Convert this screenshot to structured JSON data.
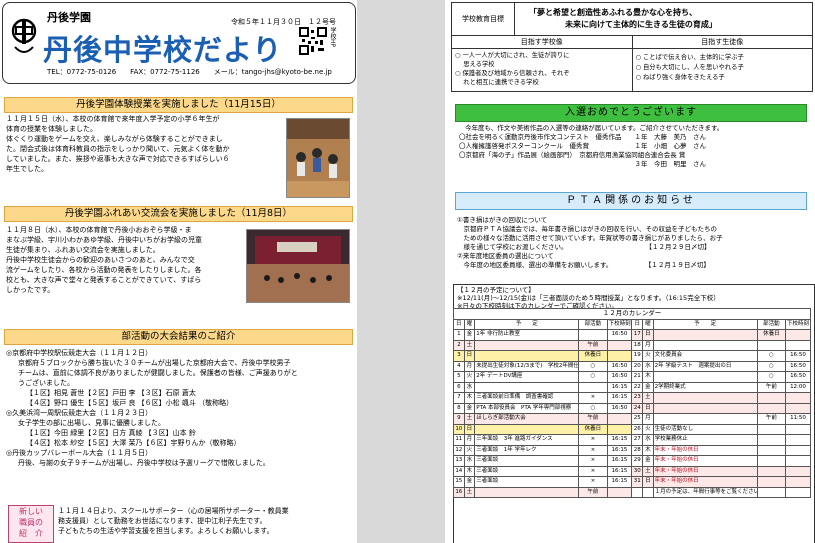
{
  "left": {
    "school_tag": "丹後学園",
    "issue": "令和５年１１月３０日　１２号号",
    "title": "丹後中学校だより",
    "qr_label": "学校HP",
    "contact": "TEL：0772-75-0126　　FAX：0772-75-1126　　メール：tango-jhs@kyoto-be.ne.jp",
    "s1": {
      "header": "丹後学園体験授業を実施しました（11月15日）",
      "lines": [
        "１１月１５日（水）、本校の体育館で来年度入学予定の小学６年生が",
        "体育の授業を体験しました。",
        "体ぐくり運動をゲームを交え、楽しみながら体験することができまし",
        "た。閉会式後は体育科教員の指示をしっかり聞いて、元気よく体を動か",
        "していました。また、挨拶や返事も大きな声で対応できるすばらしい６",
        "年生でした。"
      ]
    },
    "s2": {
      "header": "丹後学園ふれあい交流会を実施しました（11月8日）",
      "lines": [
        "１１月８日（水）、本校の体育館で丹後小おおぞら学級・ま",
        "まなぶ学級、宇川小わかあゆ学級、丹後中いちがお学級の児童",
        "生徒が集まり、ふれあい交流会を実施しました。",
        "丹後中学校生徒会からの歓迎のあいさつのあと、みんなで交",
        "流ゲームをしたり、各校から活動の発表をしたりしました。各",
        "校とも、大きな声で堂々と発表することができていて、すばら",
        "しかったです。"
      ]
    },
    "s3": {
      "header": "部活動の大会結果のご紹介",
      "lines": [
        "◎京都府中学校駅伝競走大会（１１月１２日）",
        "京都府５ブロックから勝ち抜いた３０チームが出場した京都府大会で、丹後中学校男子",
        "チームは、直前に体調不良がありましたが健闘しました。保護者の皆様、ご声援ありがと",
        "うございました。",
        "【１区】相見 蒼世【２区】戸田 李 【３区】石原 蒼太",
        "【４区】野口 優生【５区】坂戸 良 【６区】小松 颯斗 （敬称略）",
        "◎久美浜湾一周駅伝競走大会（１１月２３日）",
        "女子学生の部に出場し、見事に優勝しました。",
        "【１区】今田 緑里【２区】日方 真綾 【３区】山本 鈴",
        "【４区】松本 紗空【５区】大澤 茉乃【６区】宇野りんか（敬称略）",
        "◎丹後カップバレーボール大会（１１月５日）",
        "丹後、与謝の女子９チームが出場し、丹後中学校は予選リーグで惜敗しました。"
      ]
    },
    "new_staff": {
      "label": [
        "新しい",
        "職員の",
        "紹　介"
      ],
      "lines": [
        "１１月１４日より、スクールサポーター（心の居場所サポーター・教員業",
        "務支援員）として勤務をお世話になります、提中江利子先生です。",
        "子どもたちの生活や学習支援を担当します。よろしくお願いします。"
      ]
    }
  },
  "right": {
    "edu": {
      "label": "学校教育目標",
      "goal_1": "「夢と希望と創造性あふれる豊かな心を持ち、",
      "goal_2": "未来に向けて主体的に生きる生徒の育成」",
      "school_head": "目指す学校像",
      "student_head": "目指す生徒像",
      "school_items": [
        "○ 一人一人が大切にされ、生徒が誇りに",
        "　 思える学校",
        "○ 保護者及び地域から信頼され、それぞ",
        "　 れと相互に連携できる学校"
      ],
      "student_items": [
        "○ ことばで伝え合い、主体的に学ぶ子",
        "○ 自分も大切にし、人を思いやれる子",
        "○ ねばり強く身体をきたえる子"
      ]
    },
    "congrats": {
      "header": "入選おめでとうございます",
      "lines": [
        "今年度も、作文や美術作品の入選等の連絡が届いています。ご紹介させていただきます。",
        "〇社会を明るく運動京丹後市作文コンテスト　優秀作品　　１年　大藤　美乃　さん",
        "〇人権擁護啓発ポスターコンクール　優秀賞　　　　　　　１年　小畑　心夢　さん",
        "〇京都府「海の子」作品展（絵画部門）　京都府信用漁業協同組合連合会長 賞",
        "　　　　　　　　　　　　　　　　　　　　　　　　　　　３年　今田　明里　さん"
      ]
    },
    "pta": {
      "header": "ＰＴＡ関係のお知らせ",
      "lines": [
        "①書き損はがきの回収について",
        "　京都府ＰＴＡ協議会では、毎年書き損じはがきの回収を行い、その収益を子どもたちの",
        "　ための様々な活動に活用させて頂いています。年賀状等の書き損じがありましたら、お子",
        "　様を通じて学校にお渡しください。　　　　　　　　　　　　　【１２月２９日〆切】",
        "②来年度地区委員の選出について",
        "　今年度の地区委員様、選出の準備をお願いします。　　　　　　【１２月１９日〆切】"
      ]
    },
    "calendar": {
      "intro_1": "【１２月の予定について】",
      "intro_2": "※12/11(月)～12/15(金)は「三者面談のため５時間授業」となります。（16:15完全下校）",
      "intro_3": "※日々の下校時刻は下のカレンダーでご確認ください。",
      "title": "１２月のカレンダー",
      "col_heads": [
        "日",
        "曜",
        "予　　定",
        "部活動",
        "下校時刻"
      ],
      "left_rows": [
        [
          "1",
          "金",
          "1年 非行防止教室",
          "",
          "16:50"
        ],
        [
          "2",
          "土",
          "",
          "午前",
          ""
        ],
        [
          "3",
          "日",
          "",
          "休養日",
          ""
        ],
        [
          "4",
          "月",
          "未提出生徒対象(12/3まで)　学校2年間仕上考査",
          "○",
          "16:50"
        ],
        [
          "5",
          "火",
          "2年 デートDV講座",
          "○",
          "16:50"
        ],
        [
          "6",
          "水",
          "",
          "",
          "16:15"
        ],
        [
          "7",
          "木",
          "三者面談前日準備　調査書確認",
          "×",
          "16:15"
        ],
        [
          "8",
          "金",
          "PTA 本部役員会　PTA 学年専門部視察",
          "○",
          "16:50"
        ],
        [
          "9",
          "土",
          "ほしらぎ部活動大会",
          "午前",
          ""
        ],
        [
          "10",
          "日",
          "",
          "休養日",
          ""
        ],
        [
          "11",
          "月",
          "三年面談　3年 進路ガイダンス",
          "×",
          "16:15"
        ],
        [
          "12",
          "火",
          "三者面談　1年 学年レク",
          "×",
          "16:15"
        ],
        [
          "13",
          "水",
          "三者面談",
          "×",
          "16:15"
        ],
        [
          "14",
          "木",
          "三者面談",
          "×",
          "16:15"
        ],
        [
          "15",
          "金",
          "三者面談",
          "×",
          "16:15"
        ],
        [
          "16",
          "土",
          "",
          "午前",
          ""
        ]
      ],
      "right_rows": [
        [
          "17",
          "日",
          "",
          "休養日",
          ""
        ],
        [
          "18",
          "月",
          "",
          "",
          ""
        ],
        [
          "19",
          "火",
          "文化委員会",
          "○",
          "16:50"
        ],
        [
          "20",
          "水",
          "2年 学級テスト　週案提出の日",
          "○",
          "16:50"
        ],
        [
          "21",
          "木",
          "",
          "○",
          "16:50"
        ],
        [
          "22",
          "金",
          "2学期終業式",
          "午前",
          "12:00"
        ],
        [
          "23",
          "土",
          "",
          "",
          ""
        ],
        [
          "24",
          "日",
          "",
          "",
          ""
        ],
        [
          "25",
          "月",
          "",
          "午前",
          "11:50"
        ],
        [
          "26",
          "火",
          "生徒の活動なし",
          "",
          ""
        ],
        [
          "27",
          "水",
          "学校業務休止",
          "",
          ""
        ],
        [
          "28",
          "木",
          "年末・年始の休日",
          "",
          ""
        ],
        [
          "29",
          "金",
          "年末・年始の休日",
          "",
          ""
        ],
        [
          "30",
          "土",
          "年末・年始の休日",
          "",
          ""
        ],
        [
          "31",
          "日",
          "年末・年始の休日",
          "",
          ""
        ],
        [
          "",
          "",
          "１月の予定は、年間行事等をご覧ください。",
          "",
          ""
        ]
      ]
    }
  }
}
